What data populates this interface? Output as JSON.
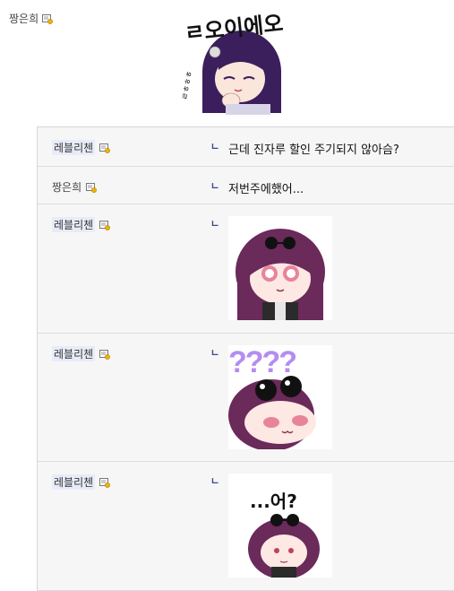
{
  "parent": {
    "author": "짱은희",
    "sticker_name": "sticker-roieo",
    "sticker_text": "ㄹ오이에오"
  },
  "replies": [
    {
      "author": "레블리첸",
      "text": "근데 진자루 할인 주기되지 않아슴?"
    },
    {
      "author": "짱은희",
      "text": "저번주에했어..."
    },
    {
      "author": "레블리첸",
      "sticker": "sticker-girl-glasses"
    },
    {
      "author": "레블리첸",
      "sticker": "sticker-girl-question",
      "sticker_text": "????"
    },
    {
      "author": "레블리첸",
      "sticker": "sticker-girl-huh",
      "sticker_text": "...어?"
    }
  ],
  "reply_arrow": "ㄴ",
  "colors": {
    "accent": "#3b4a8a",
    "name_highlight": "#e8ecf8",
    "hair": "#6a2a5a",
    "purple": "#b58cf0"
  }
}
